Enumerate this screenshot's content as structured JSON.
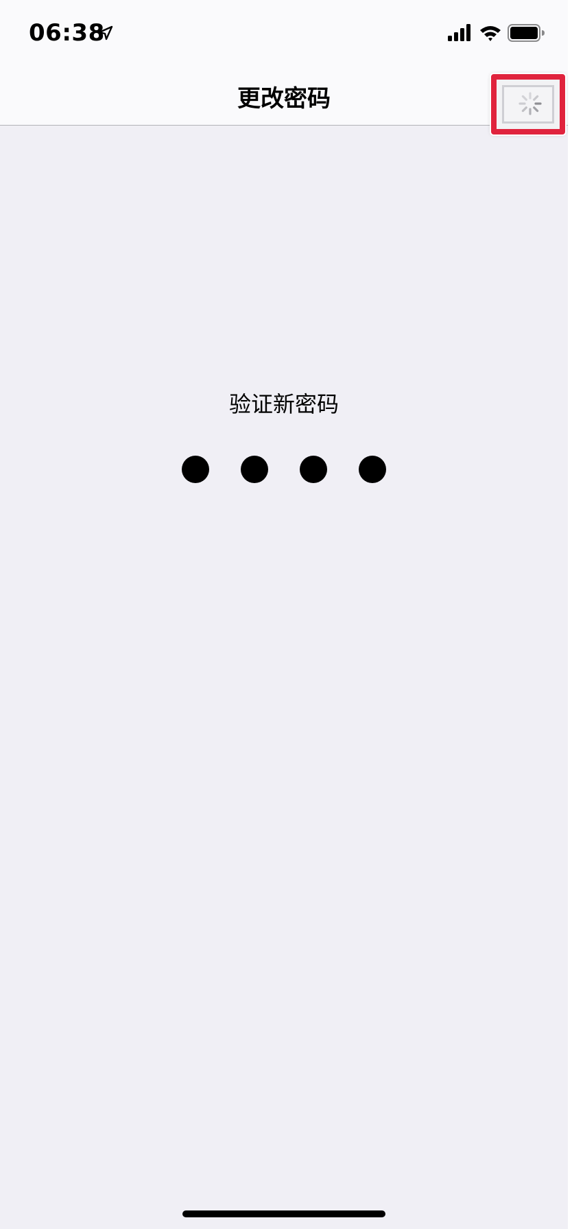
{
  "status_bar": {
    "time": "06:38",
    "icons": [
      "location-arrow-icon",
      "cellular-signal-icon",
      "wifi-icon",
      "battery-icon"
    ]
  },
  "nav": {
    "title": "更改密码",
    "right_item_icon": "activity-spinner-icon"
  },
  "passcode": {
    "prompt": "验证新密码",
    "entered_digits": 4,
    "total_digits": 4
  },
  "colors": {
    "background": "#f0eff5",
    "bar_background": "#fafafc",
    "highlight": "#e0233d",
    "dot": "#000000"
  }
}
